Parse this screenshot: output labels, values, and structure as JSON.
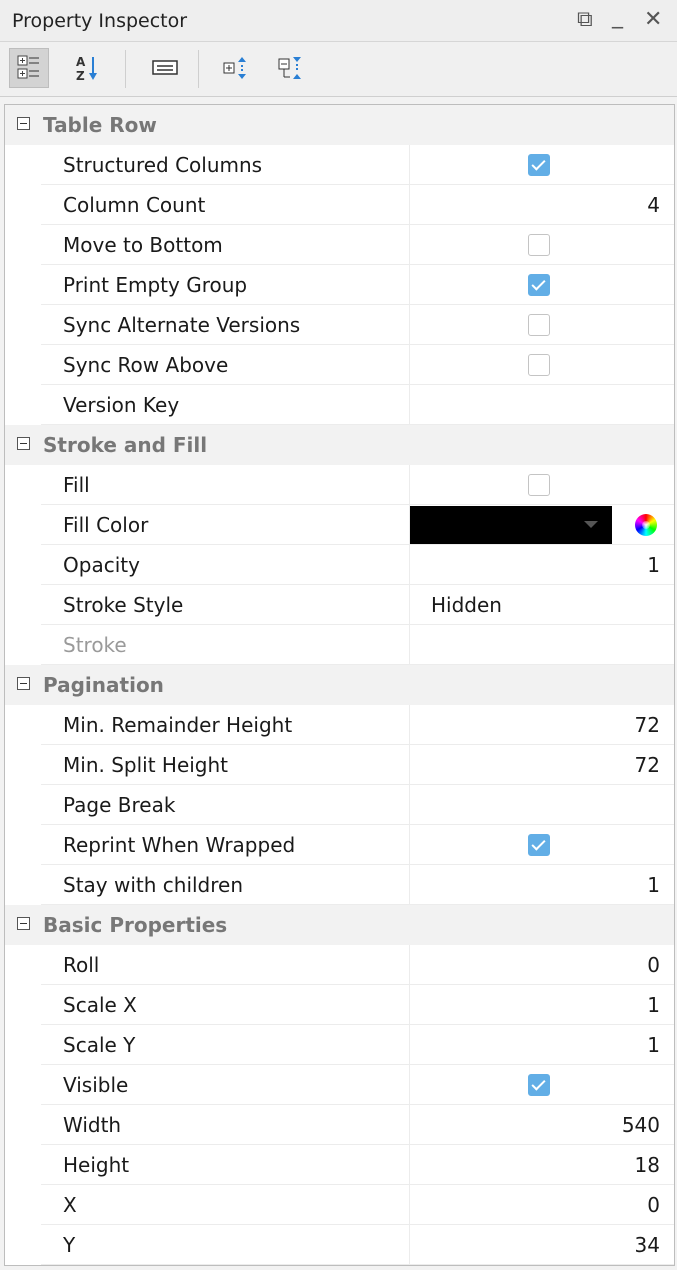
{
  "window": {
    "title": "Property Inspector",
    "restore_glyph": "⧉",
    "minimize_glyph": "_",
    "close_glyph": "✕"
  },
  "toolbar": {
    "buttons": [
      {
        "name": "categorized-view-icon",
        "active": true
      },
      {
        "name": "sort-alphabetical-icon",
        "active": false
      },
      {
        "name": "property-description-icon",
        "active": false
      },
      {
        "name": "expand-all-icon",
        "active": false
      },
      {
        "name": "collapse-all-icon",
        "active": false
      }
    ]
  },
  "colors": {
    "checkbox_checked": "#62aee6",
    "group_label": "#777777",
    "fill_color_value": "#000000"
  },
  "groups": [
    {
      "label": "Table Row",
      "rows": [
        {
          "name": "Structured Columns",
          "type": "checkbox",
          "checked": true
        },
        {
          "name": "Column Count",
          "type": "number",
          "value": "4"
        },
        {
          "name": "Move to Bottom",
          "type": "checkbox",
          "checked": false
        },
        {
          "name": "Print Empty Group",
          "type": "checkbox",
          "checked": true
        },
        {
          "name": "Sync Alternate Versions",
          "type": "checkbox",
          "checked": false
        },
        {
          "name": "Sync Row Above",
          "type": "checkbox",
          "checked": false
        },
        {
          "name": "Version Key",
          "type": "text",
          "value": ""
        }
      ]
    },
    {
      "label": "Stroke and Fill",
      "rows": [
        {
          "name": "Fill",
          "type": "checkbox",
          "checked": false
        },
        {
          "name": "Fill Color",
          "type": "color",
          "value": "#000000"
        },
        {
          "name": "Opacity",
          "type": "number",
          "value": "1"
        },
        {
          "name": "Stroke Style",
          "type": "text",
          "value": "Hidden"
        },
        {
          "name": "Stroke",
          "type": "text",
          "value": "",
          "disabled": true
        }
      ]
    },
    {
      "label": "Pagination",
      "rows": [
        {
          "name": "Min. Remainder Height",
          "type": "number",
          "value": "72"
        },
        {
          "name": "Min. Split Height",
          "type": "number",
          "value": "72"
        },
        {
          "name": "Page Break",
          "type": "text",
          "value": ""
        },
        {
          "name": "Reprint When Wrapped",
          "type": "checkbox",
          "checked": true
        },
        {
          "name": "Stay with children",
          "type": "number",
          "value": "1"
        }
      ]
    },
    {
      "label": "Basic Properties",
      "rows": [
        {
          "name": "Roll",
          "type": "number",
          "value": "0"
        },
        {
          "name": "Scale X",
          "type": "number",
          "value": "1"
        },
        {
          "name": "Scale Y",
          "type": "number",
          "value": "1"
        },
        {
          "name": "Visible",
          "type": "checkbox",
          "checked": true
        },
        {
          "name": "Width",
          "type": "number",
          "value": "540"
        },
        {
          "name": "Height",
          "type": "number",
          "value": "18"
        },
        {
          "name": "X",
          "type": "number",
          "value": "0"
        },
        {
          "name": "Y",
          "type": "number",
          "value": "34"
        }
      ]
    }
  ]
}
